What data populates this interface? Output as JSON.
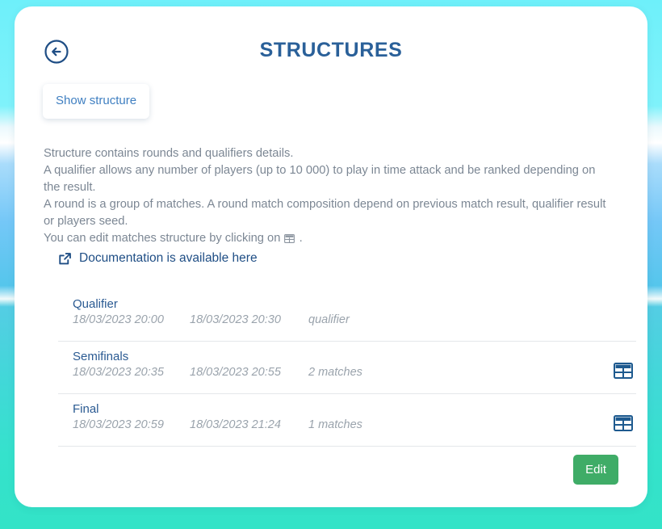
{
  "header": {
    "title": "STRUCTURES",
    "back_icon": "arrow-left-circle-icon"
  },
  "tab": {
    "label": "Show structure"
  },
  "description": {
    "line1": "Structure contains rounds and qualifiers details.",
    "line2": "A qualifier allows any number of players (up to 10 000) to play in time attack and be ranked depending on the result.",
    "line3": "A round is a group of matches. A round match composition depend on previous match result, qualifier result or players seed.",
    "line4_before": "You can edit matches structure by clicking on",
    "line4_after": ".",
    "inline_icon": "table-icon"
  },
  "documentation": {
    "label": "Documentation is available here",
    "icon": "external-link-icon"
  },
  "list": {
    "rows": [
      {
        "name": "Qualifier",
        "start": "18/03/2023 20:00",
        "end": "18/03/2023 20:30",
        "kind": "qualifier",
        "has_action": false,
        "action_icon": ""
      },
      {
        "name": "Semifinals",
        "start": "18/03/2023 20:35",
        "end": "18/03/2023 20:55",
        "kind": "2 matches",
        "has_action": true,
        "action_icon": "table-icon"
      },
      {
        "name": "Final",
        "start": "18/03/2023 20:59",
        "end": "18/03/2023 21:24",
        "kind": "1 matches",
        "has_action": true,
        "action_icon": "table-icon"
      }
    ]
  },
  "footer": {
    "edit_label": "Edit"
  },
  "colors": {
    "title": "#2a6099",
    "link": "#1f4e85",
    "tab_text": "#3f7fc1",
    "body_text": "#7c8794",
    "row_name": "#2a5a92",
    "row_meta": "#9aa3ac",
    "edit_button": "#3fac67",
    "background_top": "#6ef0fa",
    "background_bottom": "#33e3c7"
  }
}
